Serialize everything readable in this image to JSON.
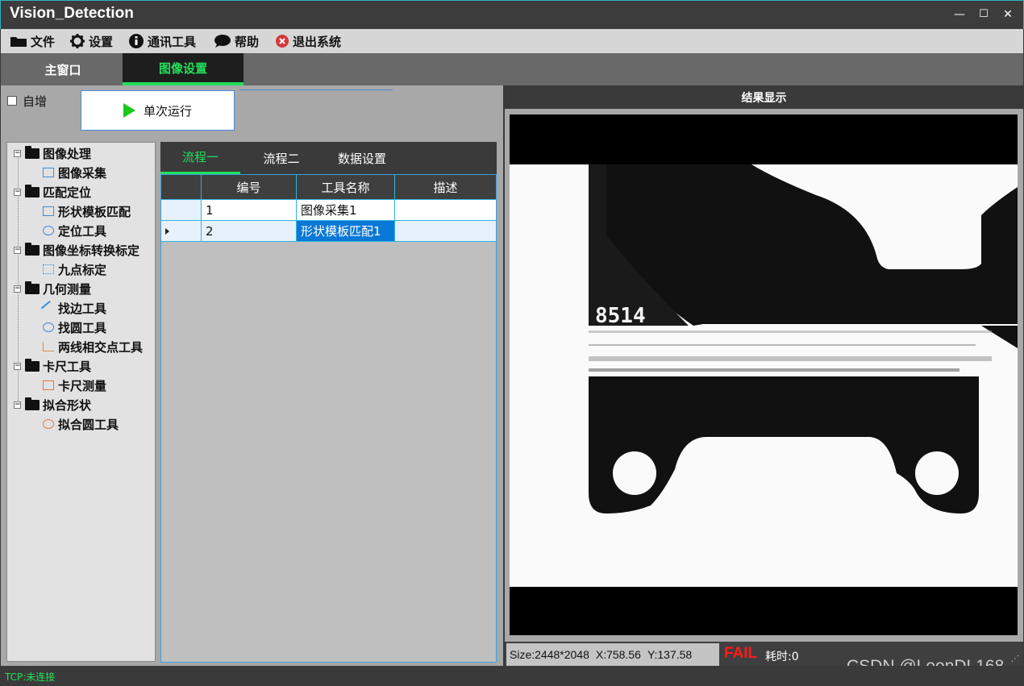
{
  "window": {
    "title": "Vision_Detection",
    "min": "—",
    "max": "☐",
    "close": "✕"
  },
  "menu": [
    {
      "label": "文件",
      "icon": "folder-icon"
    },
    {
      "label": "设置",
      "icon": "gear-icon"
    },
    {
      "label": "通讯工具",
      "icon": "info-icon"
    },
    {
      "label": "帮助",
      "icon": "chat-icon"
    },
    {
      "label": "退出系统",
      "icon": "exit-icon"
    }
  ],
  "tabs": [
    {
      "label": "主窗口",
      "active": false
    },
    {
      "label": "图像设置",
      "active": true
    }
  ],
  "toolbar": {
    "auto_increment_label": "自增",
    "auto_increment_checked": false,
    "run_once_label": "单次运行"
  },
  "tree": [
    {
      "label": "图像处理",
      "children": [
        "图像采集"
      ]
    },
    {
      "label": "匹配定位",
      "children": [
        "形状模板匹配",
        "定位工具"
      ]
    },
    {
      "label": "图像坐标转换标定",
      "children": [
        "九点标定"
      ]
    },
    {
      "label": "几何测量",
      "children": [
        "找边工具",
        "找圆工具",
        "两线相交点工具"
      ]
    },
    {
      "label": "卡尺工具",
      "children": [
        "卡尺测量"
      ]
    },
    {
      "label": "拟合形状",
      "children": [
        "拟合圆工具"
      ]
    }
  ],
  "flow_tabs": [
    {
      "label": "流程一",
      "active": true
    },
    {
      "label": "流程二",
      "active": false
    },
    {
      "label": "数据设置",
      "active": false
    }
  ],
  "grid": {
    "columns": [
      "编号",
      "工具名称",
      "描述"
    ],
    "rows": [
      {
        "id": "1",
        "name": "图像采集1",
        "desc": "",
        "current": false
      },
      {
        "id": "2",
        "name": "形状模板匹配1",
        "desc": "",
        "current": true
      }
    ]
  },
  "result": {
    "header": "结果显示",
    "size": "Size:2448*2048",
    "x": "X:758.56",
    "y": "Y:137.58",
    "status": "FAIL",
    "elapsed": "耗时:0",
    "part_marking": "8514"
  },
  "status_bar": {
    "tcp": "TCP:未连接"
  },
  "watermark": "CSDN @LeonDL168",
  "colors": {
    "accent_green": "#22e05a",
    "fail_red": "#ff1a1a",
    "selection_blue": "#0a78d7",
    "border_cyan": "#2fb4e0"
  }
}
